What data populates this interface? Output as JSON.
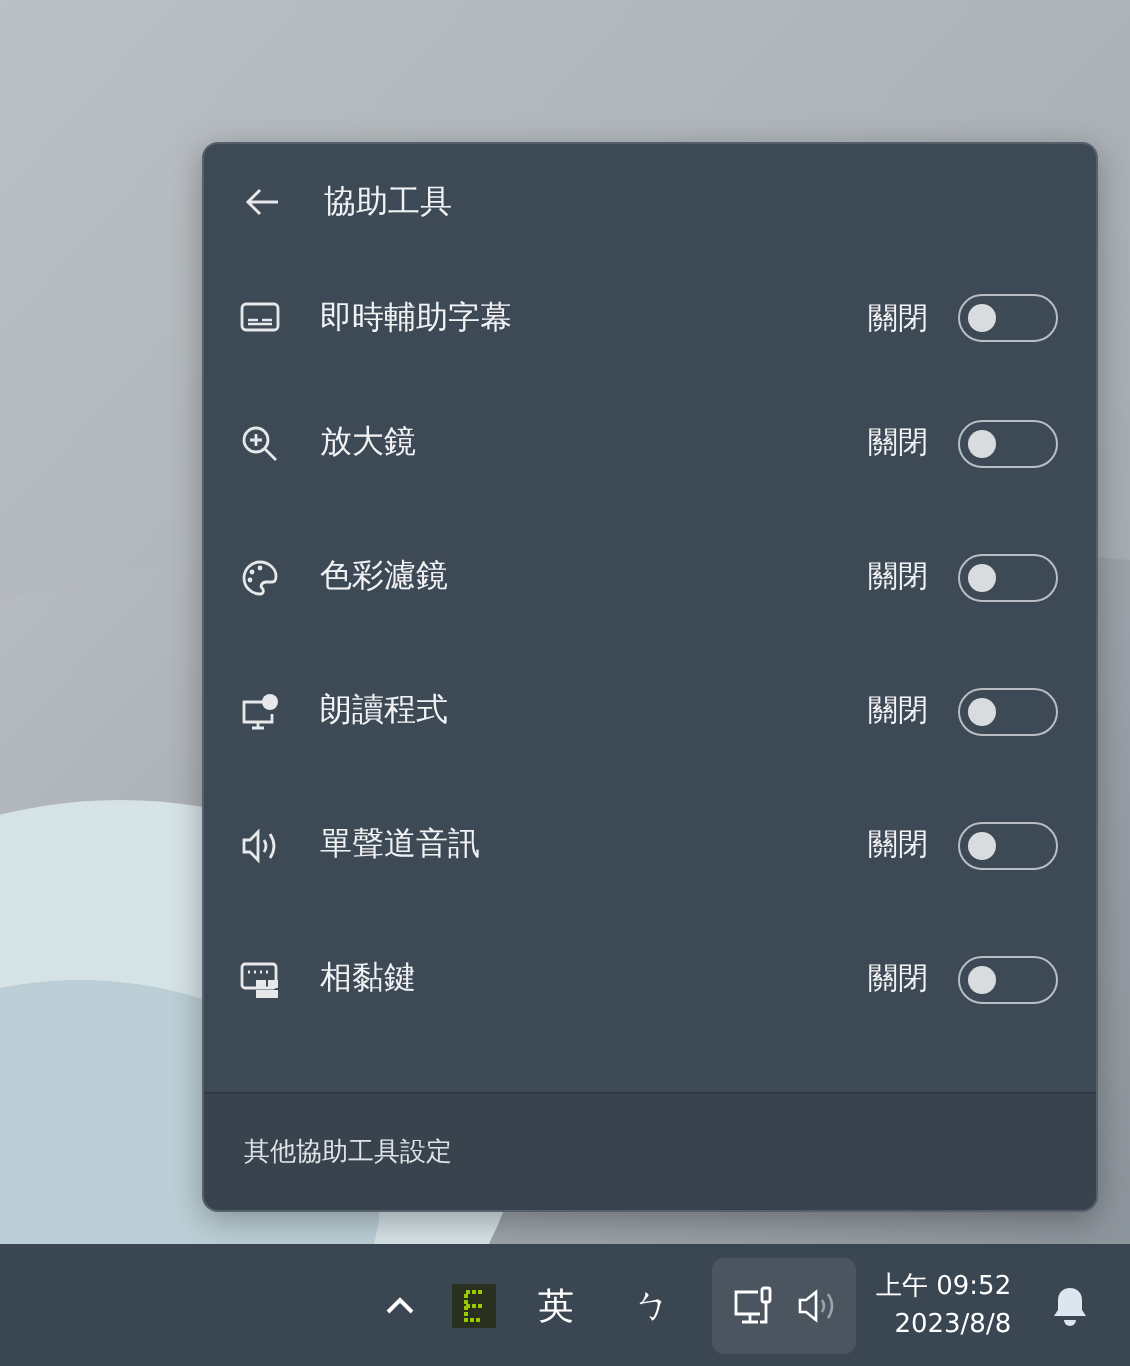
{
  "panel": {
    "title": "協助工具",
    "items": [
      {
        "label": "即時輔助字幕",
        "status": "關閉",
        "on": false
      },
      {
        "label": "放大鏡",
        "status": "關閉",
        "on": false
      },
      {
        "label": "色彩濾鏡",
        "status": "關閉",
        "on": false
      },
      {
        "label": "朗讀程式",
        "status": "關閉",
        "on": false
      },
      {
        "label": "單聲道音訊",
        "status": "關閉",
        "on": false
      },
      {
        "label": "相黏鍵",
        "status": "關閉",
        "on": false
      }
    ],
    "footer_link": "其他協助工具設定"
  },
  "taskbar": {
    "input_language": "英",
    "input_mode": "ㄅ",
    "time": "上午 09:52",
    "date": "2023/8/8"
  }
}
